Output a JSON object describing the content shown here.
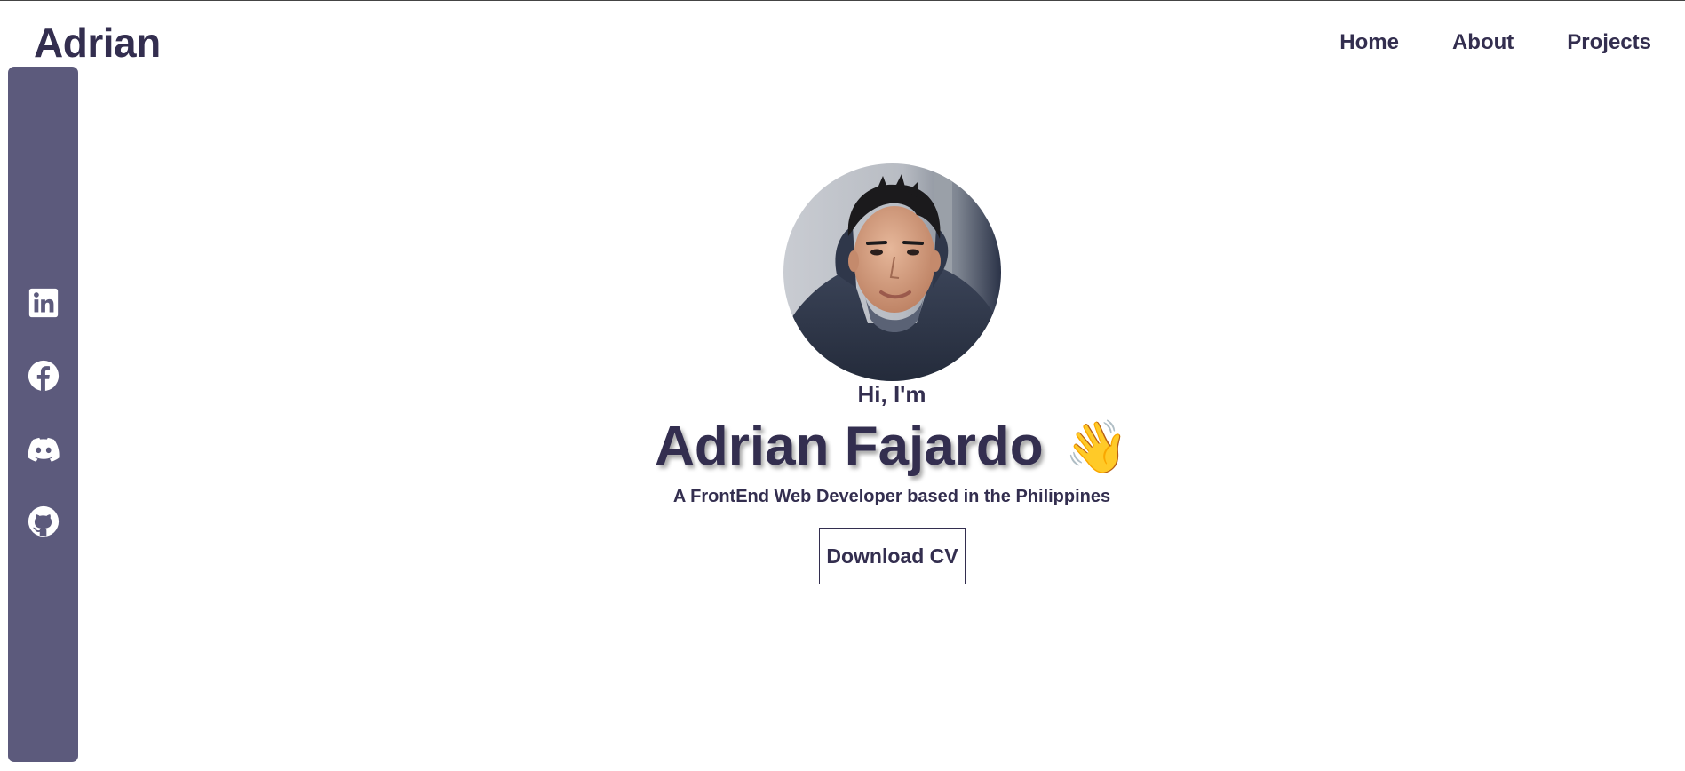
{
  "header": {
    "logo": "Adrian",
    "nav": [
      {
        "label": "Home"
      },
      {
        "label": "About"
      },
      {
        "label": "Projects"
      }
    ]
  },
  "sidebar": {
    "color": "#5c5a7c",
    "socials": [
      {
        "icon": "linkedin-icon"
      },
      {
        "icon": "facebook-icon"
      },
      {
        "icon": "discord-icon"
      },
      {
        "icon": "github-icon"
      }
    ]
  },
  "hero": {
    "greeting": "Hi, I'm",
    "name": "Adrian Fajardo",
    "wave_emoji": "👋",
    "tagline": "A FrontEnd Web Developer based in the Philippines",
    "cv_button": "Download CV"
  },
  "colors": {
    "text": "#332e4f",
    "background": "#ffffff"
  }
}
